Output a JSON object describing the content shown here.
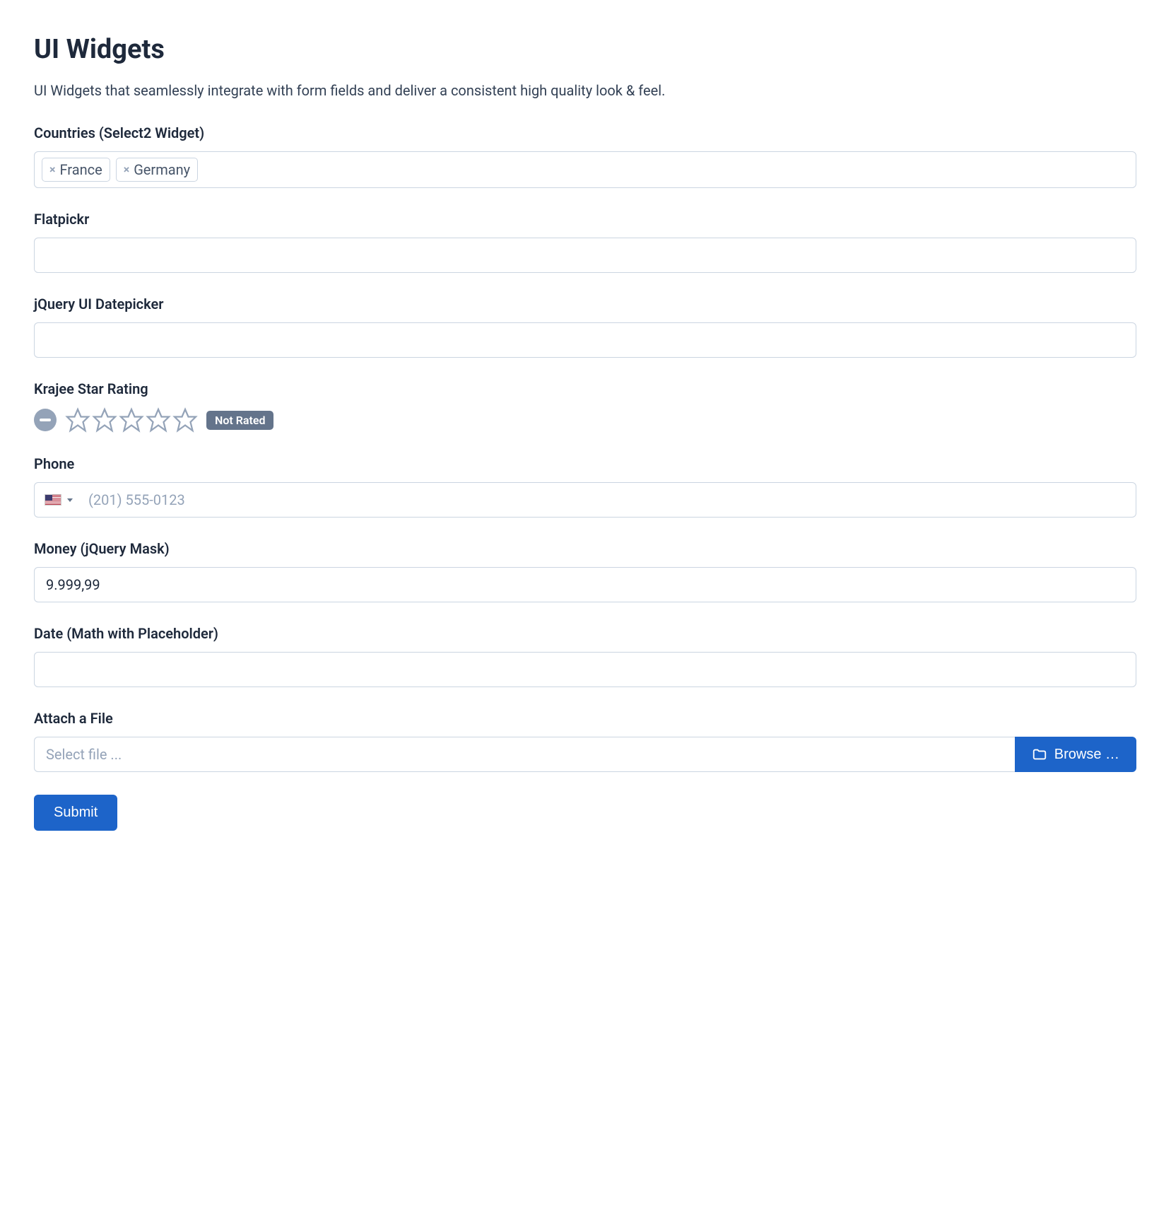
{
  "page": {
    "title": "UI Widgets",
    "subtitle": "UI Widgets that seamlessly integrate with form fields and deliver a consistent high quality look & feel."
  },
  "countries": {
    "label": "Countries (Select2 Widget)",
    "tags": [
      "France",
      "Germany"
    ]
  },
  "flatpickr": {
    "label": "Flatpickr",
    "value": ""
  },
  "jquery_datepicker": {
    "label": "jQuery UI Datepicker",
    "value": ""
  },
  "star_rating": {
    "label": "Krajee Star Rating",
    "badge": "Not Rated",
    "stars_count": 5
  },
  "phone": {
    "label": "Phone",
    "placeholder": "(201) 555-0123",
    "value": ""
  },
  "money": {
    "label": "Money (jQuery Mask)",
    "value": "9.999,99"
  },
  "date_math": {
    "label": "Date (Math with Placeholder)",
    "value": ""
  },
  "file": {
    "label": "Attach a File",
    "placeholder": "Select file ...",
    "browse_label": "Browse …"
  },
  "submit": {
    "label": "Submit"
  }
}
